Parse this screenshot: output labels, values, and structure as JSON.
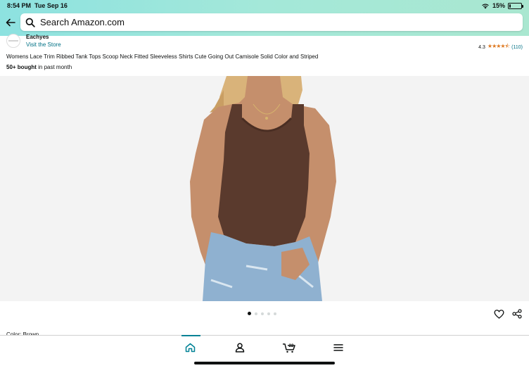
{
  "status_bar": {
    "time": "8:54 PM",
    "date": "Tue Sep 16",
    "battery_percent": "15%",
    "battery_level": 0.15
  },
  "search": {
    "placeholder": "Search Amazon.com"
  },
  "seller": {
    "name": "Eachyes",
    "visit_store": "Visit the Store"
  },
  "rating": {
    "value": "4.3",
    "stars": "★★★★⯪",
    "count": "(110)"
  },
  "product": {
    "title": "Womens Lace Trim Ribbed Tank Tops Scoop Neck Fitted Sleeveless Shirts Cute Going Out Camisole Solid Color and Striped",
    "bought_bold": "50+ bought",
    "bought_rest": " in past month"
  },
  "carousel": {
    "total": 5,
    "active": 1
  },
  "color_label": "Color: Brown",
  "tabbar": {
    "cart_count": "22",
    "active_tab": "home"
  },
  "colors": {
    "accent": "#008296",
    "link": "#007185",
    "star": "#de7921",
    "top_color": "#5a3a2d",
    "jeans": "#8fb1d0",
    "skin": "#c58f6c"
  },
  "icons": [
    "back-arrow-icon",
    "search-icon",
    "heart-icon",
    "share-icon",
    "home-icon",
    "account-icon",
    "cart-icon",
    "menu-icon"
  ]
}
